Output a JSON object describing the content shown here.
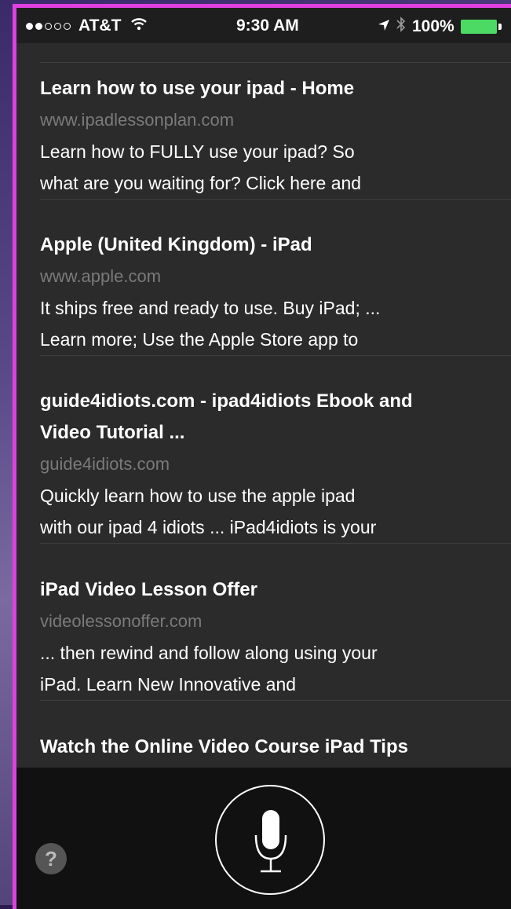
{
  "status_bar": {
    "carrier": "AT&T",
    "time": "9:30 AM",
    "battery": "100%",
    "signal_bars_filled": 2,
    "signal_bars_total": 5
  },
  "results": [
    {
      "title": "Learn how to use your ipad - Home",
      "url": "www.ipadlessonplan.com",
      "snippet": [
        "Learn how to FULLY use your ipad? So",
        "what are you waiting for? Click here and"
      ]
    },
    {
      "title": "Apple (United Kingdom) - iPad",
      "url": "www.apple.com",
      "snippet": [
        "It ships free and ready to use. Buy iPad; ...",
        "Learn more; Use the Apple Store app to"
      ]
    },
    {
      "title": "guide4idiots.com - ipad4idiots Ebook and",
      "title2": "Video Tutorial ...",
      "url": "guide4idiots.com",
      "snippet": [
        "Quickly learn how to use the apple ipad",
        "with our ipad 4 idiots ... iPad4idiots is your"
      ]
    },
    {
      "title": "iPad Video Lesson Offer",
      "url": "videolessonoffer.com",
      "snippet": [
        "... then rewind and follow along using your",
        "iPad. Learn New Innovative and"
      ]
    },
    {
      "title": "Watch the Online Video Course iPad Tips"
    }
  ],
  "help_label": "?",
  "colors": {
    "frame_border": "#e040e0",
    "battery": "#4cd964",
    "panel": "#2b2b2b",
    "url_text": "#7a7a7a"
  }
}
